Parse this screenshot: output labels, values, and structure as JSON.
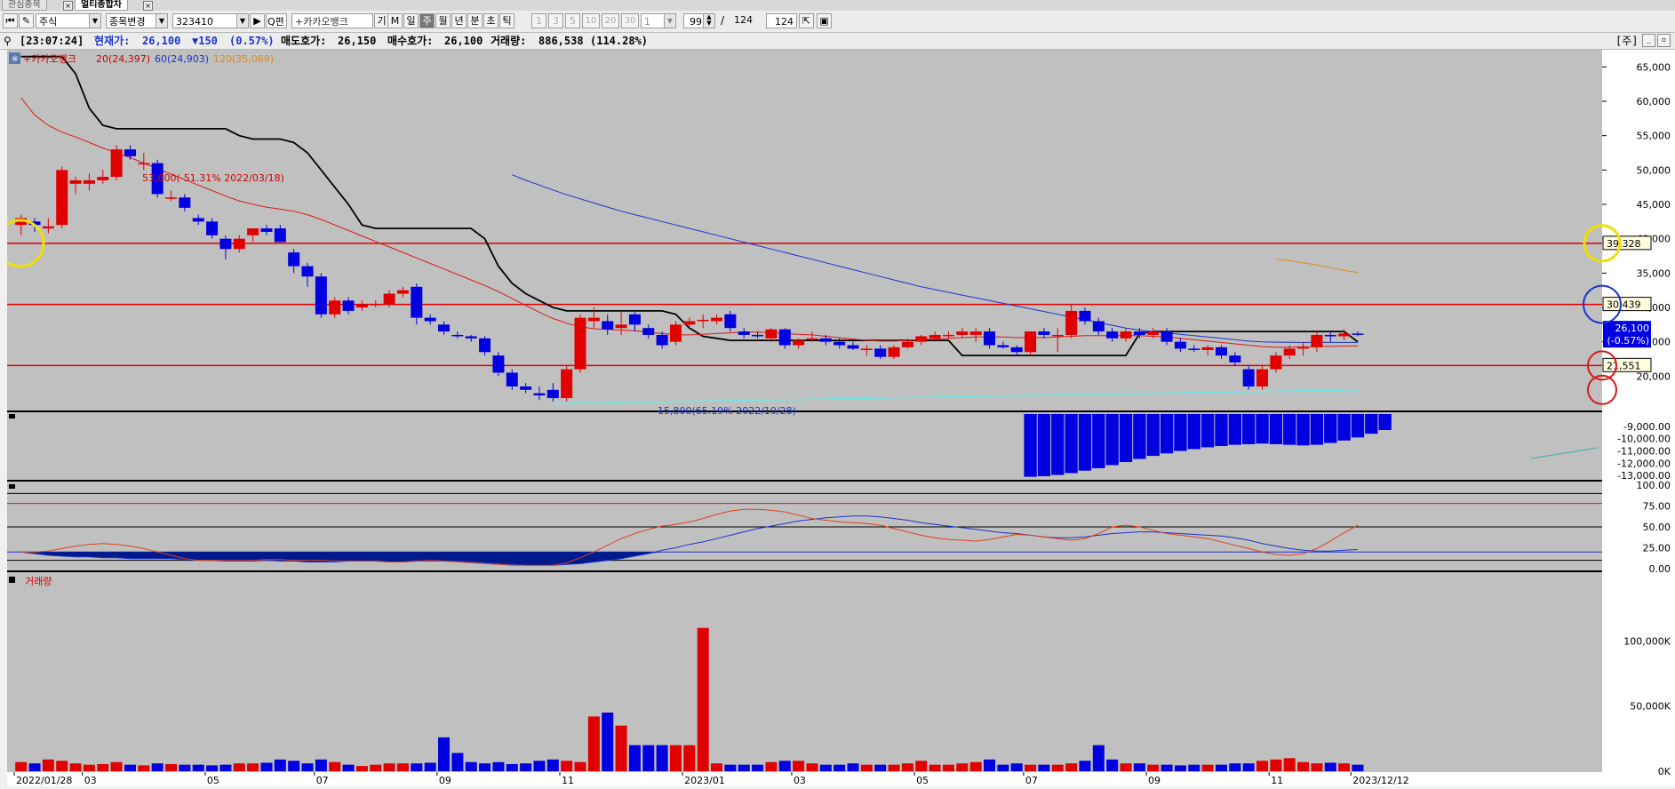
{
  "tabs": [
    {
      "label": "관심종목",
      "active": false
    },
    {
      "label": "멀티종합차",
      "active": true
    }
  ],
  "toolbar": {
    "market": "주식",
    "change_label": "종목변경",
    "code": "323410",
    "search_label": "Q편",
    "stock_name": "+카카오뱅크",
    "btn_gi": "기",
    "btn_m": "M",
    "periods": [
      {
        "label": "일",
        "selected": false
      },
      {
        "label": "주",
        "selected": true
      },
      {
        "label": "월",
        "selected": false
      },
      {
        "label": "년",
        "selected": false
      },
      {
        "label": "분",
        "selected": false
      },
      {
        "label": "초",
        "selected": false
      },
      {
        "label": "틱",
        "selected": false
      }
    ],
    "intervals": [
      "1",
      "3",
      "5",
      "10",
      "20",
      "30"
    ],
    "interval_value": "1",
    "count_value": "99",
    "count_total": "124",
    "count_slash": "/",
    "count_box": "124"
  },
  "infobar": {
    "time": "[23:07:24]",
    "price_label": "현재가:",
    "price": "26,100",
    "change": "▼150",
    "change_pct": "(0.57%)",
    "ask_label": "매도호가:",
    "ask": "26,150",
    "bid_label": "매수호가:",
    "bid": "26,100",
    "volume_label": "거래량:",
    "volume": "886,538",
    "volume_pct": "(114.28%)",
    "right_label": "[주]"
  },
  "chart_data": {
    "type": "candlestick",
    "legend": [
      {
        "name": "+카카오뱅크",
        "color": "#cc0000"
      },
      {
        "name": "20(24,397)",
        "color": "#cc0000"
      },
      {
        "name": "60(24,903)",
        "color": "#1a33cc"
      },
      {
        "name": "120(35,069)",
        "color": "#e08a1e"
      }
    ],
    "y_ticks": [
      65000,
      60000,
      55000,
      50000,
      45000,
      40000,
      35000,
      30000,
      25000,
      20000
    ],
    "y_tick_labels": [
      "65,000",
      "60,000",
      "55,000",
      "50,000",
      "45,000",
      "40,000",
      "35,000",
      "30,000",
      "25,000",
      "20,000"
    ],
    "ylim": [
      15000,
      67500
    ],
    "x_labels": [
      {
        "text": "2022/01/28",
        "i": 0
      },
      {
        "text": "03",
        "i": 5
      },
      {
        "text": "05",
        "i": 14
      },
      {
        "text": "07",
        "i": 22
      },
      {
        "text": "09",
        "i": 31
      },
      {
        "text": "11",
        "i": 40
      },
      {
        "text": "2023/01",
        "i": 49
      },
      {
        "text": "03",
        "i": 57
      },
      {
        "text": "05",
        "i": 66
      },
      {
        "text": "07",
        "i": 74
      },
      {
        "text": "09",
        "i": 83
      },
      {
        "text": "11",
        "i": 92
      },
      {
        "text": "2023/12/12",
        "i": 98
      }
    ],
    "candles": [
      [
        42000,
        43500,
        40500,
        43000
      ],
      [
        42500,
        43000,
        41000,
        42000
      ],
      [
        41500,
        43000,
        40800,
        41800
      ],
      [
        42000,
        50500,
        41500,
        50000
      ],
      [
        48000,
        49000,
        46500,
        48500
      ],
      [
        48000,
        49500,
        47000,
        48500
      ],
      [
        48500,
        50000,
        48000,
        49000
      ],
      [
        49000,
        53600,
        48500,
        53000
      ],
      [
        53000,
        53600,
        51500,
        52000
      ],
      [
        51000,
        52500,
        50000,
        51000
      ],
      [
        51000,
        51500,
        46000,
        46500
      ],
      [
        46000,
        47000,
        45500,
        46000
      ],
      [
        46000,
        46500,
        44000,
        44500
      ],
      [
        43000,
        43500,
        42000,
        42500
      ],
      [
        42500,
        43000,
        40000,
        40500
      ],
      [
        40000,
        40500,
        37000,
        38500
      ],
      [
        38500,
        40500,
        38000,
        40000
      ],
      [
        40500,
        41500,
        39500,
        41500
      ],
      [
        41500,
        42000,
        40500,
        41000
      ],
      [
        41500,
        42000,
        39500,
        39500
      ],
      [
        38000,
        38500,
        35000,
        36000
      ],
      [
        36000,
        36500,
        33000,
        34500
      ],
      [
        34500,
        35000,
        28500,
        29000
      ],
      [
        29000,
        31500,
        28500,
        31000
      ],
      [
        31000,
        31500,
        29000,
        29500
      ],
      [
        30000,
        31000,
        29500,
        30500
      ],
      [
        30500,
        31000,
        30000,
        30500
      ],
      [
        30500,
        32500,
        30000,
        32000
      ],
      [
        32000,
        33000,
        31500,
        32500
      ],
      [
        33000,
        33500,
        27500,
        28500
      ],
      [
        28500,
        29000,
        27500,
        28000
      ],
      [
        27500,
        28000,
        26000,
        26500
      ],
      [
        26000,
        26500,
        25500,
        25800
      ],
      [
        25800,
        26000,
        25000,
        25500
      ],
      [
        25500,
        25800,
        23000,
        23500
      ],
      [
        23000,
        23500,
        20000,
        20500
      ],
      [
        20500,
        21000,
        18000,
        18500
      ],
      [
        18500,
        19000,
        17500,
        18000
      ],
      [
        17500,
        18500,
        16500,
        17200
      ],
      [
        18000,
        19000,
        16300,
        16800
      ],
      [
        16800,
        21500,
        16300,
        21000
      ],
      [
        21000,
        29000,
        20500,
        28500
      ],
      [
        28000,
        30000,
        27000,
        28500
      ],
      [
        28000,
        29000,
        26000,
        26800
      ],
      [
        27000,
        29500,
        26000,
        27500
      ],
      [
        29000,
        29500,
        26500,
        27500
      ],
      [
        27000,
        27500,
        25500,
        26000
      ],
      [
        26000,
        26500,
        24000,
        24500
      ],
      [
        25000,
        28000,
        24500,
        27500
      ],
      [
        27500,
        28500,
        27000,
        28000
      ],
      [
        28000,
        29000,
        27000,
        28200
      ],
      [
        28000,
        29000,
        27500,
        28500
      ],
      [
        29000,
        29500,
        26500,
        27000
      ],
      [
        26500,
        27000,
        25500,
        26000
      ],
      [
        26000,
        26500,
        25500,
        25800
      ],
      [
        25500,
        27000,
        25000,
        26800
      ],
      [
        26800,
        27000,
        24000,
        24500
      ],
      [
        24500,
        25500,
        24000,
        25200
      ],
      [
        25500,
        26500,
        25000,
        25500
      ],
      [
        25500,
        26000,
        24500,
        25000
      ],
      [
        25000,
        25500,
        24000,
        24500
      ],
      [
        24500,
        25000,
        23800,
        24000
      ],
      [
        23800,
        24500,
        23000,
        24000
      ],
      [
        24000,
        24500,
        22500,
        22800
      ],
      [
        22800,
        24500,
        22500,
        24200
      ],
      [
        24200,
        25500,
        24000,
        25000
      ],
      [
        25000,
        26000,
        24500,
        25800
      ],
      [
        25500,
        26500,
        25000,
        26000
      ],
      [
        26000,
        26500,
        25500,
        26000
      ],
      [
        26000,
        27000,
        25500,
        26500
      ],
      [
        26000,
        27000,
        25000,
        26500
      ],
      [
        26500,
        27000,
        24000,
        24500
      ],
      [
        24500,
        25000,
        24000,
        24200
      ],
      [
        24200,
        24500,
        23000,
        23500
      ],
      [
        23500,
        26500,
        23000,
        26500
      ],
      [
        26500,
        27000,
        25500,
        26000
      ],
      [
        26000,
        27000,
        23500,
        26000
      ],
      [
        26000,
        30500,
        25500,
        29500
      ],
      [
        29500,
        30000,
        27500,
        28000
      ],
      [
        28000,
        28500,
        26000,
        26500
      ],
      [
        26500,
        27000,
        25000,
        25500
      ],
      [
        25500,
        27000,
        25000,
        26500
      ],
      [
        26500,
        27000,
        25500,
        26000
      ],
      [
        26000,
        27000,
        25500,
        26500
      ],
      [
        26500,
        27000,
        24500,
        25000
      ],
      [
        25000,
        25500,
        23500,
        24000
      ],
      [
        24000,
        24500,
        23500,
        23800
      ],
      [
        23800,
        24500,
        23000,
        24200
      ],
      [
        24200,
        24500,
        22500,
        23000
      ],
      [
        23000,
        23500,
        21500,
        22000
      ],
      [
        21000,
        21500,
        18000,
        18500
      ],
      [
        18500,
        21500,
        18000,
        21000
      ],
      [
        21000,
        23500,
        20500,
        23000
      ],
      [
        23000,
        24500,
        22500,
        24000
      ],
      [
        24000,
        25000,
        23000,
        24200
      ],
      [
        24200,
        26500,
        23500,
        26000
      ],
      [
        26000,
        26500,
        25000,
        25800
      ],
      [
        25800,
        26800,
        25200,
        26200
      ],
      [
        26200,
        26500,
        25800,
        26100
      ]
    ],
    "ma20": [
      60500,
      58000,
      56500,
      55500,
      54800,
      54000,
      53200,
      52500,
      51800,
      51000,
      50200,
      49400,
      48600,
      47800,
      47000,
      46200,
      45500,
      45000,
      44600,
      44300,
      44000,
      43500,
      42800,
      42000,
      41200,
      40400,
      39600,
      38800,
      38000,
      37200,
      36400,
      35600,
      34800,
      34000,
      33200,
      32300,
      31300,
      30300,
      29300,
      28400,
      27700,
      27200,
      26900,
      26800,
      26700,
      26600,
      26400,
      26200,
      26000,
      26000,
      26100,
      26200,
      26300,
      26400,
      26400,
      26300,
      26200,
      26100,
      26000,
      25800,
      25600,
      25400,
      25200,
      25100,
      25100,
      25200,
      25300,
      25400,
      25500,
      25600,
      25700,
      25700,
      25700,
      25600,
      25600,
      25600,
      25700,
      25800,
      25900,
      25900,
      25900,
      25900,
      25900,
      25800,
      25700,
      25500,
      25300,
      25100,
      24900,
      24700,
      24500,
      24300,
      24200,
      24200,
      24300,
      24300,
      24350,
      24380,
      24397
    ],
    "ma60_start": 36,
    "ma60": [
      49300,
      48500,
      47800,
      47100,
      46400,
      45800,
      45200,
      44600,
      44000,
      43500,
      43000,
      42500,
      42000,
      41500,
      41000,
      40500,
      40000,
      39500,
      39000,
      38500,
      38000,
      37500,
      37000,
      36500,
      36000,
      35500,
      35000,
      34500,
      34000,
      33500,
      33000,
      32600,
      32200,
      31800,
      31400,
      31000,
      30600,
      30200,
      29800,
      29400,
      29000,
      28600,
      28200,
      27800,
      27400,
      27000,
      26700,
      26500,
      26300,
      26100,
      25900,
      25700,
      25500,
      25300,
      25100,
      25000,
      24950,
      24920,
      24910,
      24905,
      24900,
      24900,
      24903
    ],
    "ma120_start": 92,
    "ma120": [
      37000,
      36800,
      36500,
      36200,
      35800,
      35400,
      35069
    ],
    "black_start": 0,
    "black": [
      66500,
      66500,
      66500,
      66500,
      64000,
      59000,
      56500,
      56000,
      56000,
      56000,
      56000,
      56000,
      56000,
      56000,
      56000,
      56000,
      55000,
      54500,
      54500,
      54500,
      54000,
      52500,
      50000,
      47500,
      45000,
      42000,
      41500,
      41500,
      41500,
      41500,
      41500,
      41500,
      41500,
      41500,
      40000,
      36000,
      33500,
      32000,
      31000,
      30000,
      29500,
      29500,
      29500,
      29500,
      29500,
      29500,
      29500,
      29500,
      29000,
      27000,
      25800,
      25500,
      25200,
      25200,
      25200,
      25200,
      25200,
      25200,
      25200,
      25200,
      25200,
      25200,
      25200,
      25200,
      25200,
      25200,
      25200,
      25200,
      25200,
      23000,
      23000,
      23000,
      23000,
      23000,
      23000,
      23000,
      23000,
      23000,
      23000,
      23000,
      23000,
      23000,
      26200,
      26500,
      26500,
      26500,
      26500,
      26500,
      26500,
      26500,
      26500,
      26500,
      26500,
      26500,
      26500,
      26500,
      26500,
      26500,
      25000
    ],
    "cyan_start": 39,
    "cyan_end": 98,
    "cyan_values": [
      16000,
      18000
    ],
    "h_lines": [
      {
        "value": 39328,
        "label": "39,328"
      },
      {
        "value": 30439,
        "label": "30,439"
      },
      {
        "value": 21551,
        "label": "21,551"
      }
    ],
    "annotations": {
      "high": "53,600(-51.31% 2022/03/18)",
      "low": "15,800(65.19% 2022/10/28)"
    },
    "current_price_label": "26,100",
    "current_change_label": "(-0.57%)",
    "panel2": {
      "y_tick_labels": [
        "-9,000.00",
        "-10,000.00",
        "-11,000.00",
        "-12,000.00",
        "-13,000.00"
      ],
      "ylim": [
        -13200,
        -8000
      ],
      "bars_start": 74,
      "bars": [
        -13100,
        -13050,
        -12950,
        -12800,
        -12600,
        -12400,
        -12150,
        -11900,
        -11650,
        -11400,
        -11200,
        -11000,
        -10850,
        -10700,
        -10600,
        -10500,
        -10450,
        -10400,
        -10450,
        -10500,
        -10550,
        -10500,
        -10350,
        -10150,
        -9900,
        -9600,
        -9300
      ]
    },
    "panel3": {
      "y_tick_labels": [
        "100.00",
        "75.00",
        "50.00",
        "25.00",
        "0.00"
      ],
      "ylim": [
        0,
        100
      ],
      "blue": [
        20,
        18,
        16,
        15,
        14,
        14,
        13,
        13,
        12,
        12,
        12,
        12,
        11,
        10,
        10,
        9,
        9,
        9,
        10,
        9,
        9,
        8,
        8,
        8,
        9,
        9,
        9,
        8,
        8,
        9,
        9,
        9,
        9,
        8,
        7,
        6,
        5,
        4,
        4,
        4,
        5,
        6,
        8,
        10,
        12,
        15,
        18,
        22,
        25,
        29,
        32,
        36,
        40,
        44,
        48,
        51,
        54,
        57,
        59,
        61,
        62,
        63,
        63,
        62,
        60,
        58,
        55,
        53,
        51,
        49,
        47,
        45,
        43,
        42,
        40,
        38,
        37,
        37,
        38,
        40,
        42,
        43,
        44,
        44,
        43,
        42,
        41,
        40,
        39,
        37,
        34,
        30,
        27,
        24,
        22,
        21,
        21,
        22,
        23
      ],
      "red": [
        20,
        20,
        21,
        24,
        27,
        29,
        30,
        29,
        27,
        24,
        20,
        16,
        12,
        10,
        10,
        10,
        10,
        10,
        11,
        11,
        10,
        10,
        10,
        9,
        9,
        9,
        9,
        8,
        8,
        9,
        10,
        9,
        8,
        7,
        6,
        5,
        4,
        4,
        4,
        4,
        7,
        13,
        20,
        28,
        36,
        42,
        47,
        51,
        53,
        56,
        60,
        65,
        69,
        71,
        71,
        70,
        68,
        64,
        60,
        58,
        56,
        55,
        54,
        52,
        48,
        44,
        40,
        37,
        35,
        34,
        33,
        35,
        38,
        41,
        40,
        38,
        36,
        34,
        36,
        42,
        50,
        52,
        50,
        46,
        42,
        40,
        38,
        36,
        32,
        28,
        24,
        20,
        17,
        16,
        18,
        24,
        33,
        43,
        52
      ],
      "h_levels": [
        90,
        78,
        50,
        20,
        10
      ]
    },
    "panel4": {
      "title": "거래량",
      "y_tick_labels": [
        "100,000K",
        "50,000K",
        "0K"
      ],
      "ylim": [
        0,
        150000
      ],
      "bars": [
        7000,
        6000,
        9000,
        8000,
        6000,
        5000,
        5500,
        7000,
        5000,
        4500,
        6000,
        5500,
        5000,
        5000,
        4500,
        5000,
        6000,
        6000,
        6500,
        9000,
        8000,
        6000,
        9000,
        7000,
        5000,
        4000,
        5000,
        6000,
        6000,
        6000,
        6500,
        26000,
        14000,
        7000,
        6000,
        7000,
        5500,
        6000,
        8000,
        9000,
        8000,
        7000,
        42000,
        45000,
        35000,
        20000,
        20000,
        20000,
        20000,
        20000,
        110000,
        6000,
        5000,
        5000,
        5000,
        7000,
        8000,
        8000,
        6000,
        5000,
        5000,
        6000,
        5000,
        5000,
        5000,
        6000,
        8000,
        5000,
        5000,
        6000,
        7000,
        9000,
        5000,
        6000,
        5000,
        5000,
        5000,
        6000,
        8000,
        20000,
        9000,
        6000,
        6000,
        5000,
        5000,
        4500,
        5000,
        5000,
        5000,
        6000,
        6000,
        8000,
        9000,
        10000,
        7000,
        6000,
        6500,
        6000,
        5000
      ],
      "colors": "updown"
    }
  }
}
